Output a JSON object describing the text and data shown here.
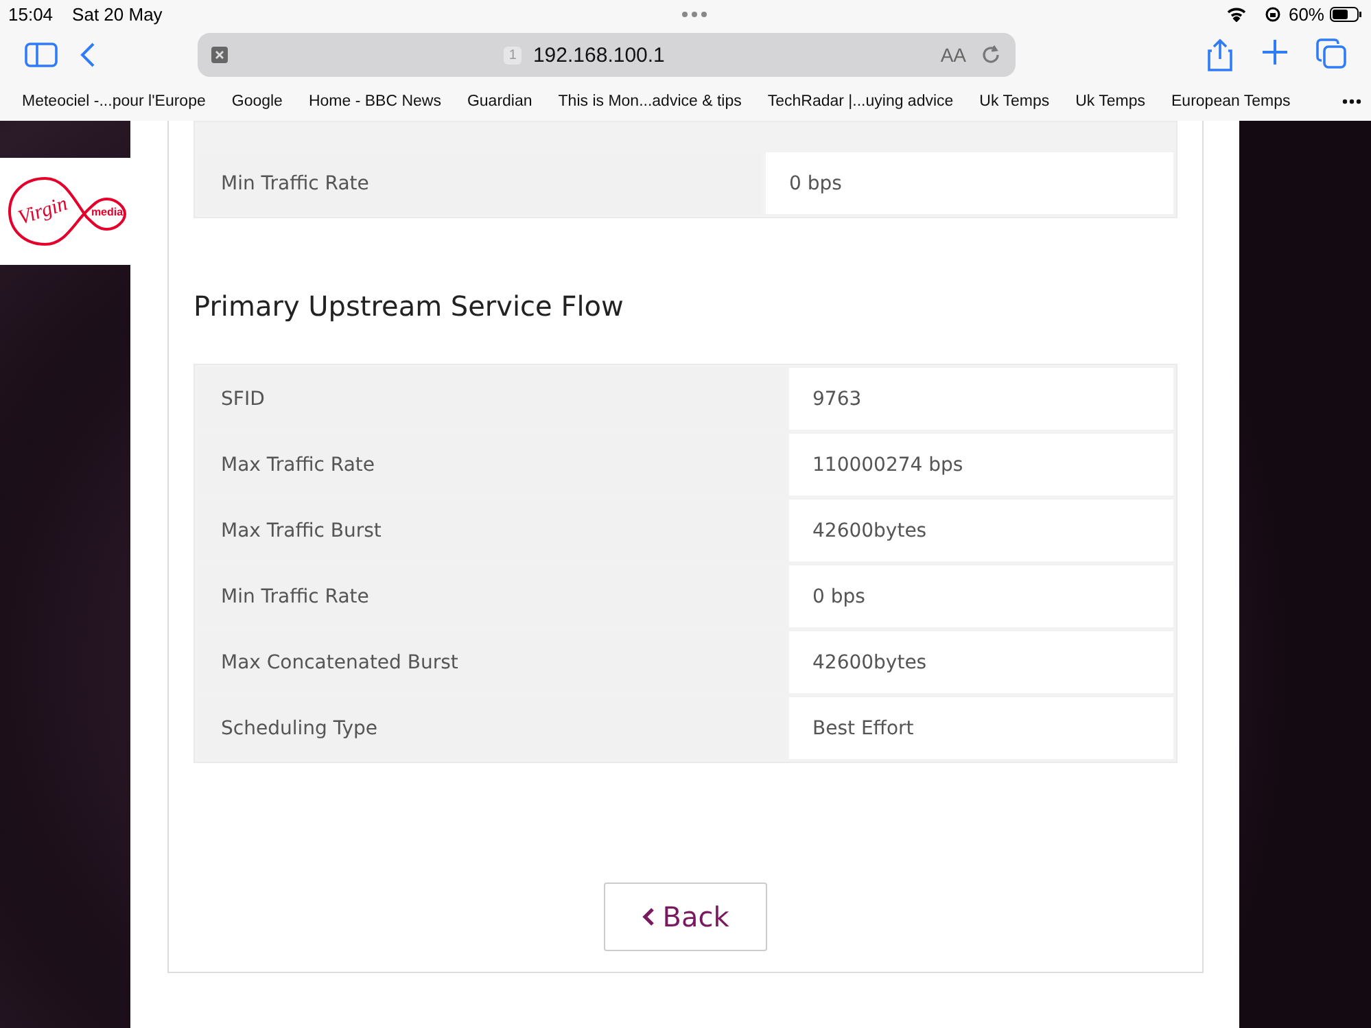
{
  "status_bar": {
    "time": "15:04",
    "date": "Sat 20 May",
    "battery": "60%"
  },
  "address_bar": {
    "tab_count": "1",
    "url": "192.168.100.1",
    "text_size": "AA"
  },
  "bookmarks": [
    "Meteociel -...pour l'Europe",
    "Google",
    "Home - BBC News",
    "Guardian",
    "This is Mon...advice & tips",
    "TechRadar |...uying advice",
    "Uk Temps",
    "Uk Temps",
    "European Temps"
  ],
  "logo": {
    "script": "Virgin",
    "word": "media"
  },
  "downstream_table": {
    "rows": [
      {
        "label": "Min Traffic Rate",
        "value": "0 bps"
      }
    ]
  },
  "upstream": {
    "heading": "Primary Upstream Service Flow",
    "rows": [
      {
        "label": "SFID",
        "value": "9763"
      },
      {
        "label": "Max Traffic Rate",
        "value": "110000274 bps"
      },
      {
        "label": "Max Traffic Burst",
        "value": "42600bytes"
      },
      {
        "label": "Min Traffic Rate",
        "value": "0 bps"
      },
      {
        "label": "Max Concatenated Burst",
        "value": "42600bytes"
      },
      {
        "label": "Scheduling Type",
        "value": "Best Effort"
      }
    ]
  },
  "back_button": {
    "label": "Back"
  }
}
